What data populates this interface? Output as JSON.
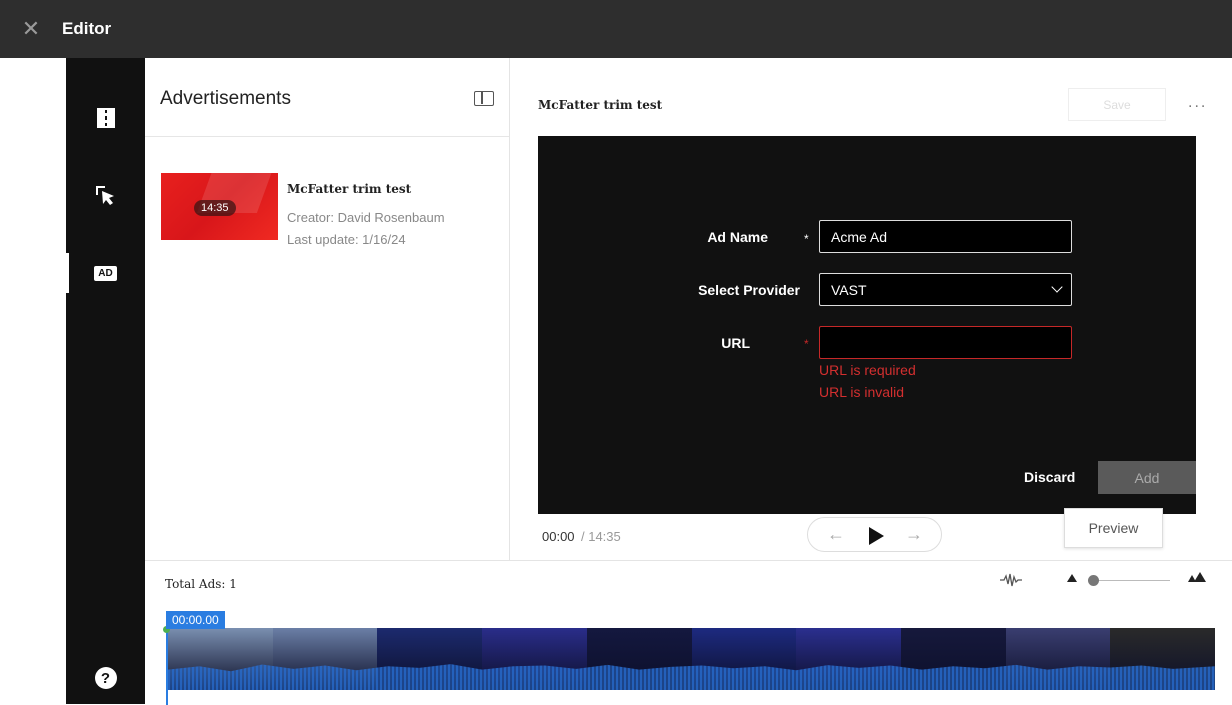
{
  "topbar": {
    "title": "Editor",
    "close_icon": "close-icon"
  },
  "sidebar": {
    "items": [
      {
        "name": "chapters-icon"
      },
      {
        "name": "interactive-icon"
      },
      {
        "name": "ad-icon",
        "label": "AD"
      }
    ],
    "help_label": "?"
  },
  "ads_panel": {
    "title": "Advertisements",
    "items": [
      {
        "name": "McFatter trim test",
        "duration": "14:35",
        "creator": "Creator: David Rosenbaum",
        "last_update": "Last update: 1/16/24"
      }
    ]
  },
  "editor": {
    "title": "McFatter trim test",
    "save_label": "Save",
    "more_label": "...",
    "form": {
      "ad_name_label": "Ad Name",
      "ad_name_value": "Acme Ad",
      "provider_label": "Select Provider",
      "provider_value": "VAST",
      "url_label": "URL",
      "url_value": "",
      "required_mark": "*",
      "errors": [
        "URL is required",
        "URL is invalid"
      ]
    },
    "discard_label": "Discard",
    "add_label": "Add",
    "preview_label": "Preview",
    "time_current": "00:00",
    "time_total": "/  14:35"
  },
  "timeline": {
    "total_ads": "Total Ads: 1",
    "playhead_time": "00:00.00",
    "frames": [
      "#7a8fb0",
      "#6b7fa6",
      "#1c2a6e",
      "#2a2d8a",
      "#14183f",
      "#1d2a80",
      "#2b2f8f",
      "#16193c",
      "#3a3e70",
      "#2a2a2a"
    ],
    "accent": "#2a7de1"
  }
}
